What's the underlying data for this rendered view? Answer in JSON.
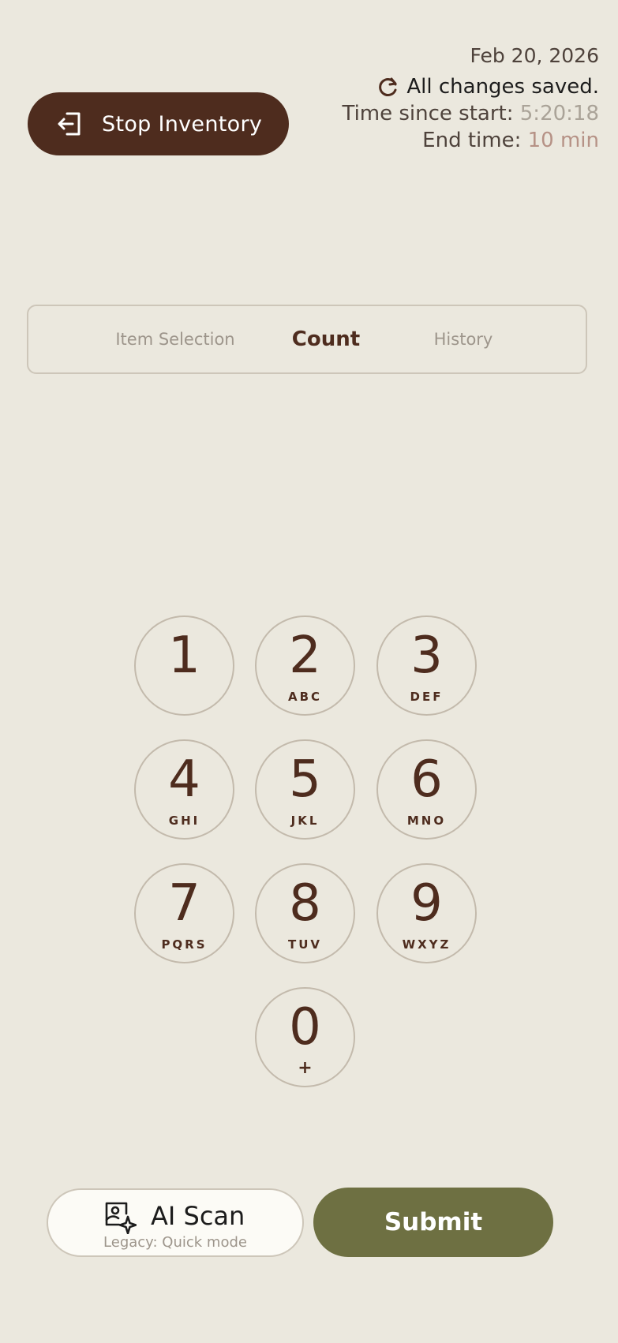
{
  "header": {
    "stop_label": "Stop Inventory",
    "date": "Feb 20, 2026",
    "saved_status": "All changes saved.",
    "since_label": "Time since start:",
    "since_value": "5:20:18",
    "end_label": "End time:",
    "end_value": "10 min"
  },
  "tabs": [
    {
      "label": "Item Selection",
      "active": false
    },
    {
      "label": "Count",
      "active": true
    },
    {
      "label": "History",
      "active": false
    }
  ],
  "keypad": [
    {
      "digit": "1",
      "letters": ""
    },
    {
      "digit": "2",
      "letters": "ABC"
    },
    {
      "digit": "3",
      "letters": "DEF"
    },
    {
      "digit": "4",
      "letters": "GHI"
    },
    {
      "digit": "5",
      "letters": "JKL"
    },
    {
      "digit": "6",
      "letters": "MNO"
    },
    {
      "digit": "7",
      "letters": "PQRS"
    },
    {
      "digit": "8",
      "letters": "TUV"
    },
    {
      "digit": "9",
      "letters": "WXYZ"
    },
    {
      "digit": "0",
      "letters": "+"
    }
  ],
  "actions": {
    "ai_scan_label": "AI Scan",
    "ai_scan_sub": "Legacy: Quick mode",
    "submit_label": "Submit"
  },
  "icons": {
    "stop": "exit-door-icon",
    "saved": "refresh-icon",
    "ai_scan": "image-sparkle-icon"
  },
  "colors": {
    "primary": "#4e2c1e",
    "submit": "#6e7042",
    "background": "#ebe8de"
  }
}
